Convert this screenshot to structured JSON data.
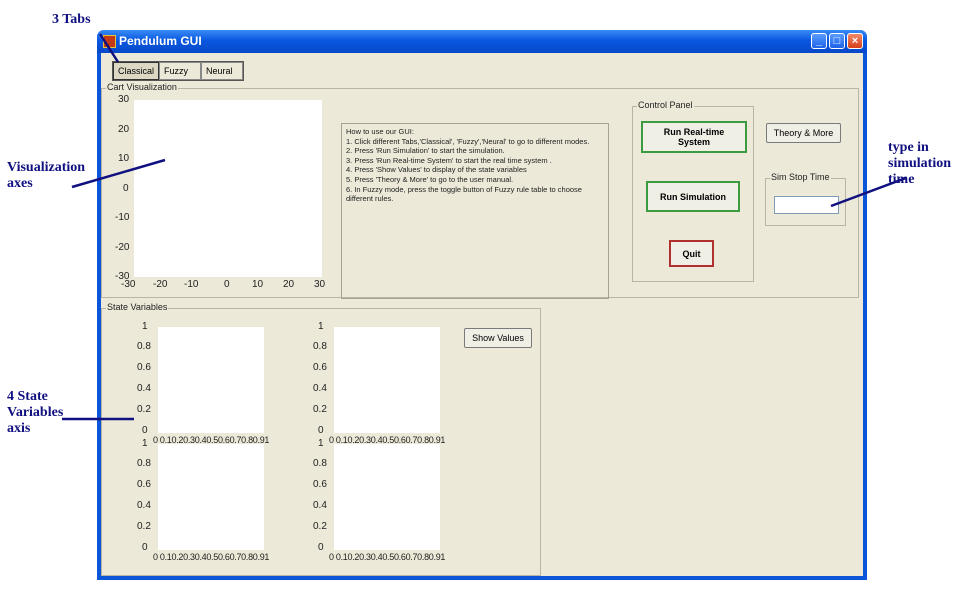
{
  "annotations": {
    "tabs": "3 Tabs",
    "visualization": "Visualization axes",
    "state": "4 State Variables axis",
    "sim_time": "type in simulation time"
  },
  "window": {
    "title": "Pendulum GUI"
  },
  "tabs": [
    "Classical",
    "Fuzzy",
    "Neural"
  ],
  "cart_panel": {
    "label": "Cart Visualization",
    "y_ticks": [
      "30",
      "20",
      "10",
      "0",
      "-10",
      "-20",
      "-30"
    ],
    "x_ticks": [
      "-30",
      "-20",
      "-10",
      "0",
      "10",
      "20",
      "30"
    ]
  },
  "instructions": [
    "How to use our GUI:",
    "1. Click different Tabs,'Classical', 'Fuzzy','Neural' to go to different modes.",
    "2. Press 'Run Simulation' to start the simulation.",
    "3. Press 'Run Real-time System' to start the real time system .",
    "4. Press 'Show Values' to display of the state variables",
    "5. Press 'Theory & More' to go to the user manual.",
    "6. In Fuzzy mode, press the toggle button of Fuzzy rule table to choose different rules."
  ],
  "control_panel": {
    "label": "Control Panel",
    "run_realtime": "Run Real-time System",
    "run_sim": "Run Simulation",
    "quit": "Quit"
  },
  "theory_button": "Theory & More",
  "sim_stop": {
    "label": "Sim Stop Time",
    "value": ""
  },
  "state_panel": {
    "label": "State Variables",
    "show_values": "Show Values",
    "y_ticks": [
      "1",
      "0.8",
      "0.6",
      "0.4",
      "0.2",
      "0"
    ],
    "x_ticks_a": "0 0.10.20.30.40.50.60.70.80.91",
    "x_ticks_b": "0 0.10.20.30.40.50.60.70.80.91"
  },
  "colors": {
    "titlebar": "#0a58e0",
    "face": "#ece9d8",
    "annotation": "#101080",
    "green_btn": "#3c9a40",
    "red_btn": "#b03030"
  }
}
